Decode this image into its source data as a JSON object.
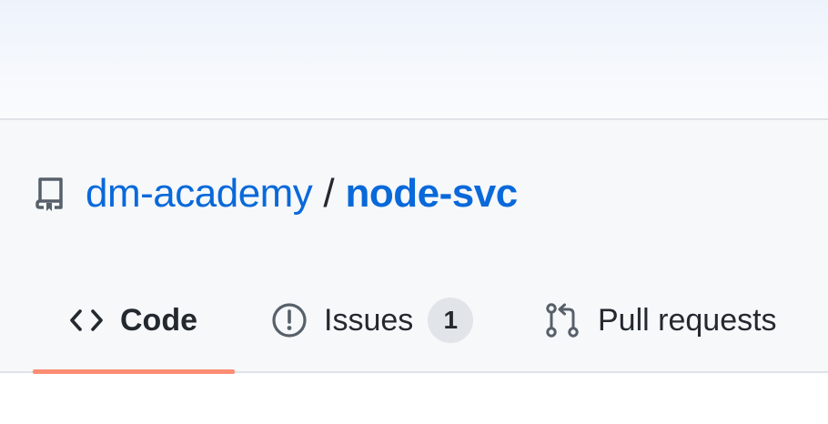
{
  "repo": {
    "owner": "dm-academy",
    "separator": "/",
    "name": "node-svc",
    "icon": "repo-icon"
  },
  "tabs": [
    {
      "label": "Code",
      "icon": "code-icon",
      "selected": true
    },
    {
      "label": "Issues",
      "icon": "issue-opened-icon",
      "counter": "1",
      "selected": false
    },
    {
      "label": "Pull requests",
      "icon": "git-pull-request-icon",
      "selected": false
    }
  ],
  "colors": {
    "link": "#0969da",
    "text": "#24292f",
    "muted_icon": "#57606a",
    "selected_tab_underline": "#fd8c73",
    "header_background": "#f6f8fa",
    "counter_background": "#e1e4e8",
    "border": "#dfe2e6"
  }
}
